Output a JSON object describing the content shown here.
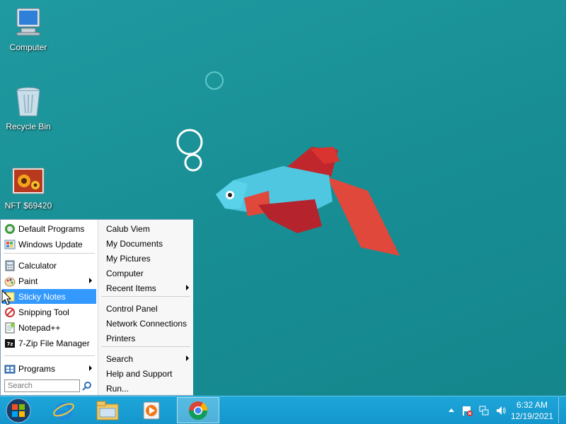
{
  "desktop": {
    "icons": [
      {
        "label": "Computer",
        "icon": "computer-icon"
      },
      {
        "label": "Recycle Bin",
        "icon": "recycle-bin-icon"
      },
      {
        "label": "NFT $69420",
        "icon": "image-file-icon"
      }
    ]
  },
  "start_menu": {
    "left_items": [
      {
        "label": "Default Programs",
        "icon": "default-programs-icon"
      },
      {
        "label": "Windows Update",
        "icon": "windows-update-icon"
      },
      {
        "label": "Calculator",
        "icon": "calculator-icon"
      },
      {
        "label": "Paint",
        "icon": "paint-icon",
        "submenu": true
      },
      {
        "label": "Sticky Notes",
        "icon": "sticky-notes-icon",
        "selected": true
      },
      {
        "label": "Snipping Tool",
        "icon": "snipping-tool-icon"
      },
      {
        "label": "Notepad++",
        "icon": "notepad-plus-plus-icon"
      },
      {
        "label": "7-Zip File Manager",
        "icon": "seven-zip-icon"
      }
    ],
    "programs_label": "Programs",
    "search_placeholder": "Search",
    "right_items": [
      {
        "label": "Calub Viem"
      },
      {
        "label": "My Documents"
      },
      {
        "label": "My Pictures"
      },
      {
        "label": "Computer"
      },
      {
        "label": "Recent Items",
        "submenu": true
      },
      {
        "label": "Control Panel"
      },
      {
        "label": "Network Connections"
      },
      {
        "label": "Printers"
      },
      {
        "label": "Search",
        "submenu": true
      },
      {
        "label": "Help and Support"
      },
      {
        "label": "Run..."
      }
    ]
  },
  "taskbar": {
    "buttons": [
      "start-orb-icon",
      "internet-explorer-icon",
      "file-explorer-icon",
      "media-player-icon",
      "chrome-icon"
    ],
    "clock_time": "6:32 AM",
    "clock_date": "12/19/2021"
  },
  "colors": {
    "desktop_bg": "#1a9298",
    "taskbar": "#1ea6d9",
    "selection": "#3399ff"
  }
}
